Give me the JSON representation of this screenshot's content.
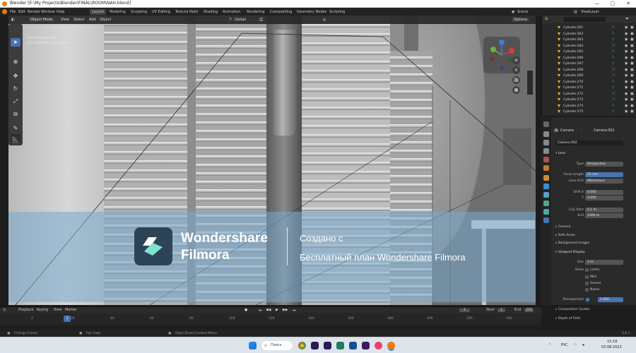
{
  "window": {
    "title": "Blender [E:\\My Projects\\Blender\\FINAL\\ROOM\\NAH.blend]",
    "minimize": "—",
    "maximize": "▢",
    "close": "✕"
  },
  "menu": {
    "items": [
      "File",
      "Edit",
      "Render",
      "Window",
      "Help"
    ],
    "workspaces": [
      "Layout",
      "Modeling",
      "Sculpting",
      "UV Editing",
      "Texture Paint",
      "Shading",
      "Animation",
      "Rendering",
      "Compositing",
      "Geometry Nodes",
      "Scripting"
    ],
    "active_workspace": "Layout",
    "scene": "Scene",
    "view_layer": "ViewLayer"
  },
  "viewport": {
    "mode": "Object Mode",
    "menus": [
      "View",
      "Select",
      "Add",
      "Object"
    ],
    "transform_orientation": "Global",
    "options_label": "Options",
    "info_line1": "User Perspective",
    "info_line2": "(1) Collection | Camera"
  },
  "watermark": {
    "brand_line1": "Wondershare",
    "brand_line2": "Filmora",
    "made_with": "Создано с",
    "plan": "Бесплатный план Wondershare Filmora"
  },
  "outliner": {
    "rows": [
      "Cylinder.261",
      "Cylinder.262",
      "Cylinder.263",
      "Cylinder.264",
      "Cylinder.265",
      "Cylinder.266",
      "Cylinder.267",
      "Cylinder.268",
      "Cylinder.269",
      "Cylinder.270",
      "Cylinder.271",
      "Cylinder.272",
      "Cylinder.273",
      "Cylinder.274",
      "Cylinder.275"
    ]
  },
  "properties": {
    "breadcrumb_camera": "Camera",
    "breadcrumb_data": "Camera.002",
    "data_name": "Camera.002",
    "lens_section": "Lens",
    "type_label": "Type",
    "type_value": "Perspective",
    "focal_label": "Focal Length",
    "focal_value": "35 mm",
    "lens_unit_label": "Lens Unit",
    "lens_unit_value": "Millimeters",
    "shift_x_label": "Shift X",
    "shift_x_value": "0.000",
    "shift_y_label": "Y",
    "shift_y_value": "0.000",
    "clip_start_label": "Clip Start",
    "clip_start_value": "0.1 m",
    "clip_end_label": "End",
    "clip_end_value": "1000 m",
    "camera_sub": "Camera",
    "safe_areas_sub": "Safe Areas",
    "bg_images_sub": "Background Images",
    "viewport_display": "Viewport Display",
    "size_label": "Size",
    "size_value": "1 m",
    "show_label": "Show",
    "show_items": [
      "Limits",
      "Mist",
      "Sensor",
      "Name"
    ],
    "passepartout_label": "Passepartout",
    "passepartout_value": "1.000",
    "composition_sub": "Composition Guides",
    "dof_sub": "Depth of Field"
  },
  "timeline": {
    "menus": [
      "Playback",
      "Keying",
      "View",
      "Marker"
    ],
    "current_frame": "1",
    "start_label": "Start",
    "start_value": "1",
    "end_label": "End",
    "end_value": "250",
    "ticks": [
      "2",
      "20",
      "40",
      "60",
      "80",
      "100",
      "120",
      "140",
      "160",
      "180",
      "200",
      "220",
      "240"
    ]
  },
  "statusbar": {
    "items": [
      "Change Frame",
      "Pan View",
      "Dope Sheet Context Menu"
    ],
    "version": "3.6.1"
  },
  "taskbar": {
    "search_label": "Поиск",
    "lang": "РУС",
    "time": "15:18",
    "date": "03.08.2023"
  },
  "colors": {
    "accent": "#4772b3",
    "blender_orange": "#e87d0d",
    "watermark_band": "#78aacd"
  }
}
